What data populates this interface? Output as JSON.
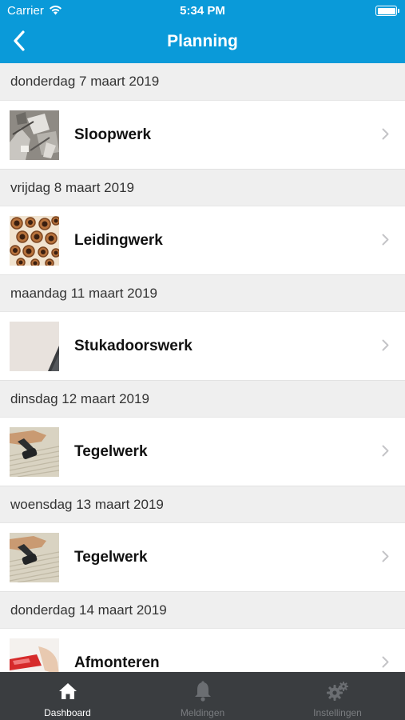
{
  "status_bar": {
    "carrier": "Carrier",
    "time": "5:34 PM",
    "battery_level": 1.0
  },
  "nav": {
    "title": "Planning",
    "back_icon": "chevron-left-icon"
  },
  "sections": [
    {
      "date": "donderdag 7 maart 2019",
      "items": [
        {
          "label": "Sloopwerk",
          "thumbnail": "demolition-rubble"
        }
      ]
    },
    {
      "date": "vrijdag 8 maart 2019",
      "items": [
        {
          "label": "Leidingwerk",
          "thumbnail": "copper-pipes"
        }
      ]
    },
    {
      "date": "maandag 11 maart 2019",
      "items": [
        {
          "label": "Stukadoorswerk",
          "thumbnail": "plastered-wall"
        }
      ]
    },
    {
      "date": "dinsdag 12 maart 2019",
      "items": [
        {
          "label": "Tegelwerk",
          "thumbnail": "tile-adhesive-trowel"
        }
      ]
    },
    {
      "date": "woensdag 13 maart 2019",
      "items": [
        {
          "label": "Tegelwerk",
          "thumbnail": "tile-adhesive-trowel"
        }
      ]
    },
    {
      "date": "donderdag 14 maart 2019",
      "items": [
        {
          "label": "Afmonteren",
          "thumbnail": "finishing-assembly"
        }
      ]
    }
  ],
  "tab_bar": {
    "tabs": [
      {
        "label": "Dashboard",
        "icon": "home-icon",
        "active": true
      },
      {
        "label": "Meldingen",
        "icon": "bell-icon",
        "active": false
      },
      {
        "label": "Instellingen",
        "icon": "gears-icon",
        "active": false
      }
    ]
  },
  "colors": {
    "header_blue": "#0a9ad9",
    "tabbar_bg": "#3a3d40",
    "section_bg": "#efefef"
  }
}
